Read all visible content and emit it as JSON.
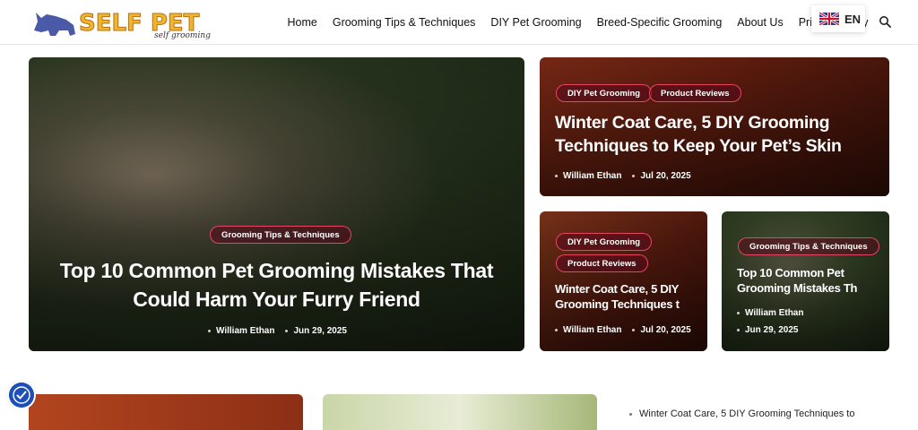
{
  "logo": {
    "text": "SELF PET",
    "subtitle": "self grooming"
  },
  "nav": {
    "items": [
      {
        "label": "Home"
      },
      {
        "label": "Grooming Tips & Techniques"
      },
      {
        "label": "DIY Pet Grooming"
      },
      {
        "label": "Breed-Specific Grooming"
      },
      {
        "label": "About Us"
      },
      {
        "label": "Privacy Policy"
      }
    ],
    "language": "EN"
  },
  "featured": {
    "main": {
      "tag": "Grooming Tips & Techniques",
      "title_line1": "Top 10 Common Pet Grooming Mistakes That",
      "title_line2": "Could Harm Your Furry Friend",
      "author": "William Ethan",
      "date": "Jun 29, 2025"
    },
    "top_right": {
      "tags": [
        "DIY Pet Grooming",
        "Product Reviews"
      ],
      "title_line1": "Winter Coat Care, 5 DIY Grooming",
      "title_line2": "Techniques to Keep Your Pet’s Skin",
      "author": "William Ethan",
      "date": "Jul 20, 2025"
    },
    "small_left": {
      "tags": [
        "DIY Pet Grooming",
        "Product Reviews"
      ],
      "title_line1": "Winter Coat Care, 5 DIY",
      "title_line2": "Grooming Techniques t",
      "author": "William Ethan",
      "date": "Jul 20, 2025"
    },
    "small_right": {
      "tag": "Grooming Tips & Techniques",
      "title_line1": "Top 10 Common Pet",
      "title_line2": "Grooming Mistakes Th",
      "author": "William Ethan",
      "date": "Jun 29, 2025"
    }
  },
  "sidebar": {
    "link": "Winter Coat Care, 5 DIY Grooming Techniques to"
  },
  "colors": {
    "accent_tag_border": "#ff506e",
    "header_bg": "#ffffff",
    "a11y_button": "#1e4fb8"
  }
}
